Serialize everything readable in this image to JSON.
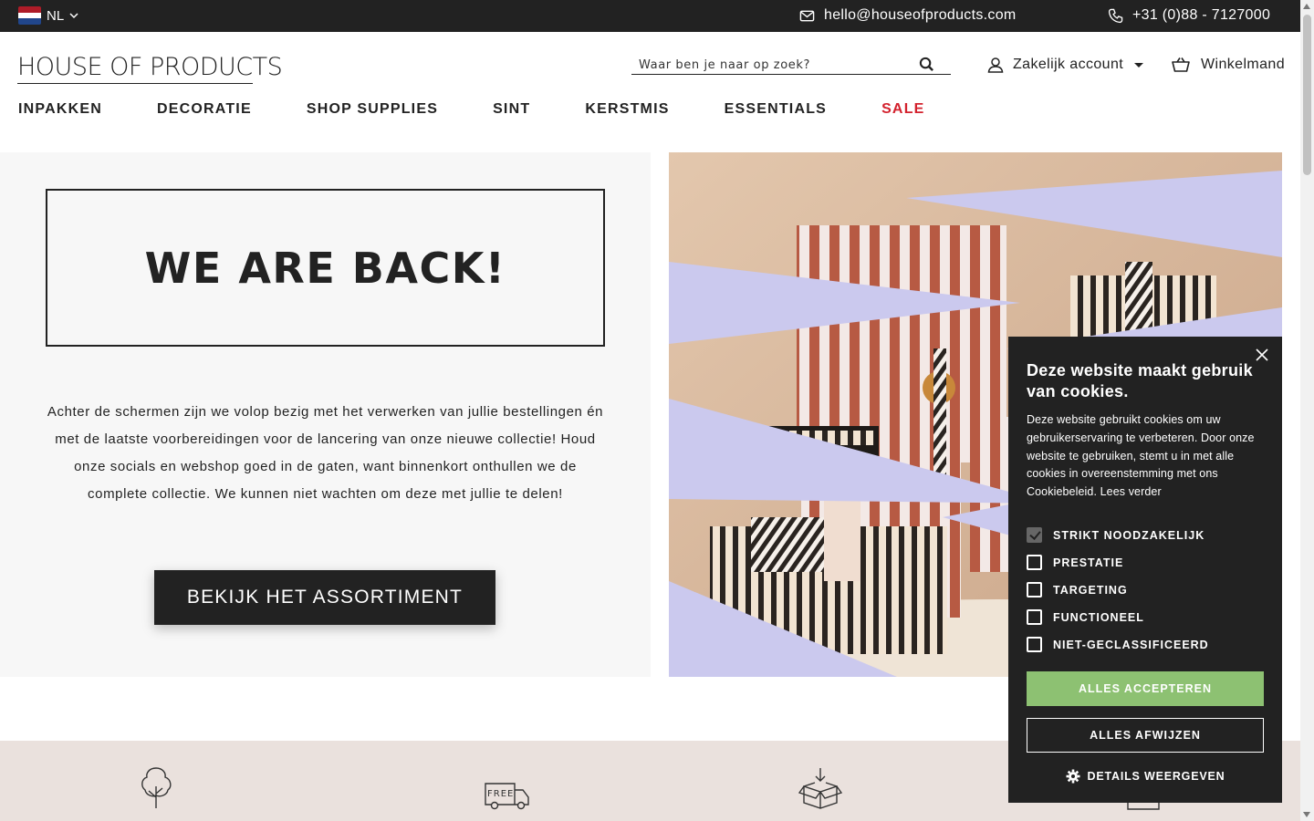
{
  "topbar": {
    "language": "NL",
    "email": "hello@houseofproducts.com",
    "phone": "+31 (0)88 - 7127000"
  },
  "header": {
    "logo": "HOUSE OF PRODUCTS",
    "search_placeholder": "Waar ben je naar op zoek?",
    "account_label": "Zakelijk account",
    "cart_label": "Winkelmand"
  },
  "nav": {
    "items": [
      "INPAKKEN",
      "DECORATIE",
      "SHOP SUPPLIES",
      "SINT",
      "KERSTMIS",
      "ESSENTIALS",
      "SALE"
    ],
    "sale_color": "#d3212d"
  },
  "hero": {
    "title": "WE ARE BACK!",
    "text": "Achter de schermen zijn we volop bezig met het verwerken van jullie bestellingen én met de laatste voorbereidingen voor de lancering van onze nieuwe collectie! Houd onze socials en webshop goed in de gaten, want binnenkort onthullen we de complete collectie. We kunnen niet wachten om deze met jullie te delen!",
    "button": "BEKIJK HET ASSORTIMENT",
    "image_icon": "gift-packaging-photo"
  },
  "usp": {
    "icons": [
      "tree-icon",
      "free-delivery-truck-icon",
      "box-icon",
      "bag-icon"
    ]
  },
  "cookie": {
    "title": "Deze website maakt gebruik van cookies.",
    "text": "Deze website gebruikt cookies om uw gebruikerservaring te verbeteren. Door onze website te gebruiken, stemt u in met alle cookies in overeenstemming met ons Cookiebeleid. Lees verder",
    "options": [
      {
        "label": "STRIKT NOODZAKELIJK",
        "checked": true
      },
      {
        "label": "PRESTATIE",
        "checked": false
      },
      {
        "label": "TARGETING",
        "checked": false
      },
      {
        "label": "FUNCTIONEEL",
        "checked": false
      },
      {
        "label": "NIET-GECLASSIFICEERD",
        "checked": false
      }
    ],
    "accept": "ALLES ACCEPTEREN",
    "reject": "ALLES AFWIJZEN",
    "details": "DETAILS WEERGEVEN",
    "accept_color": "#8dc172"
  }
}
